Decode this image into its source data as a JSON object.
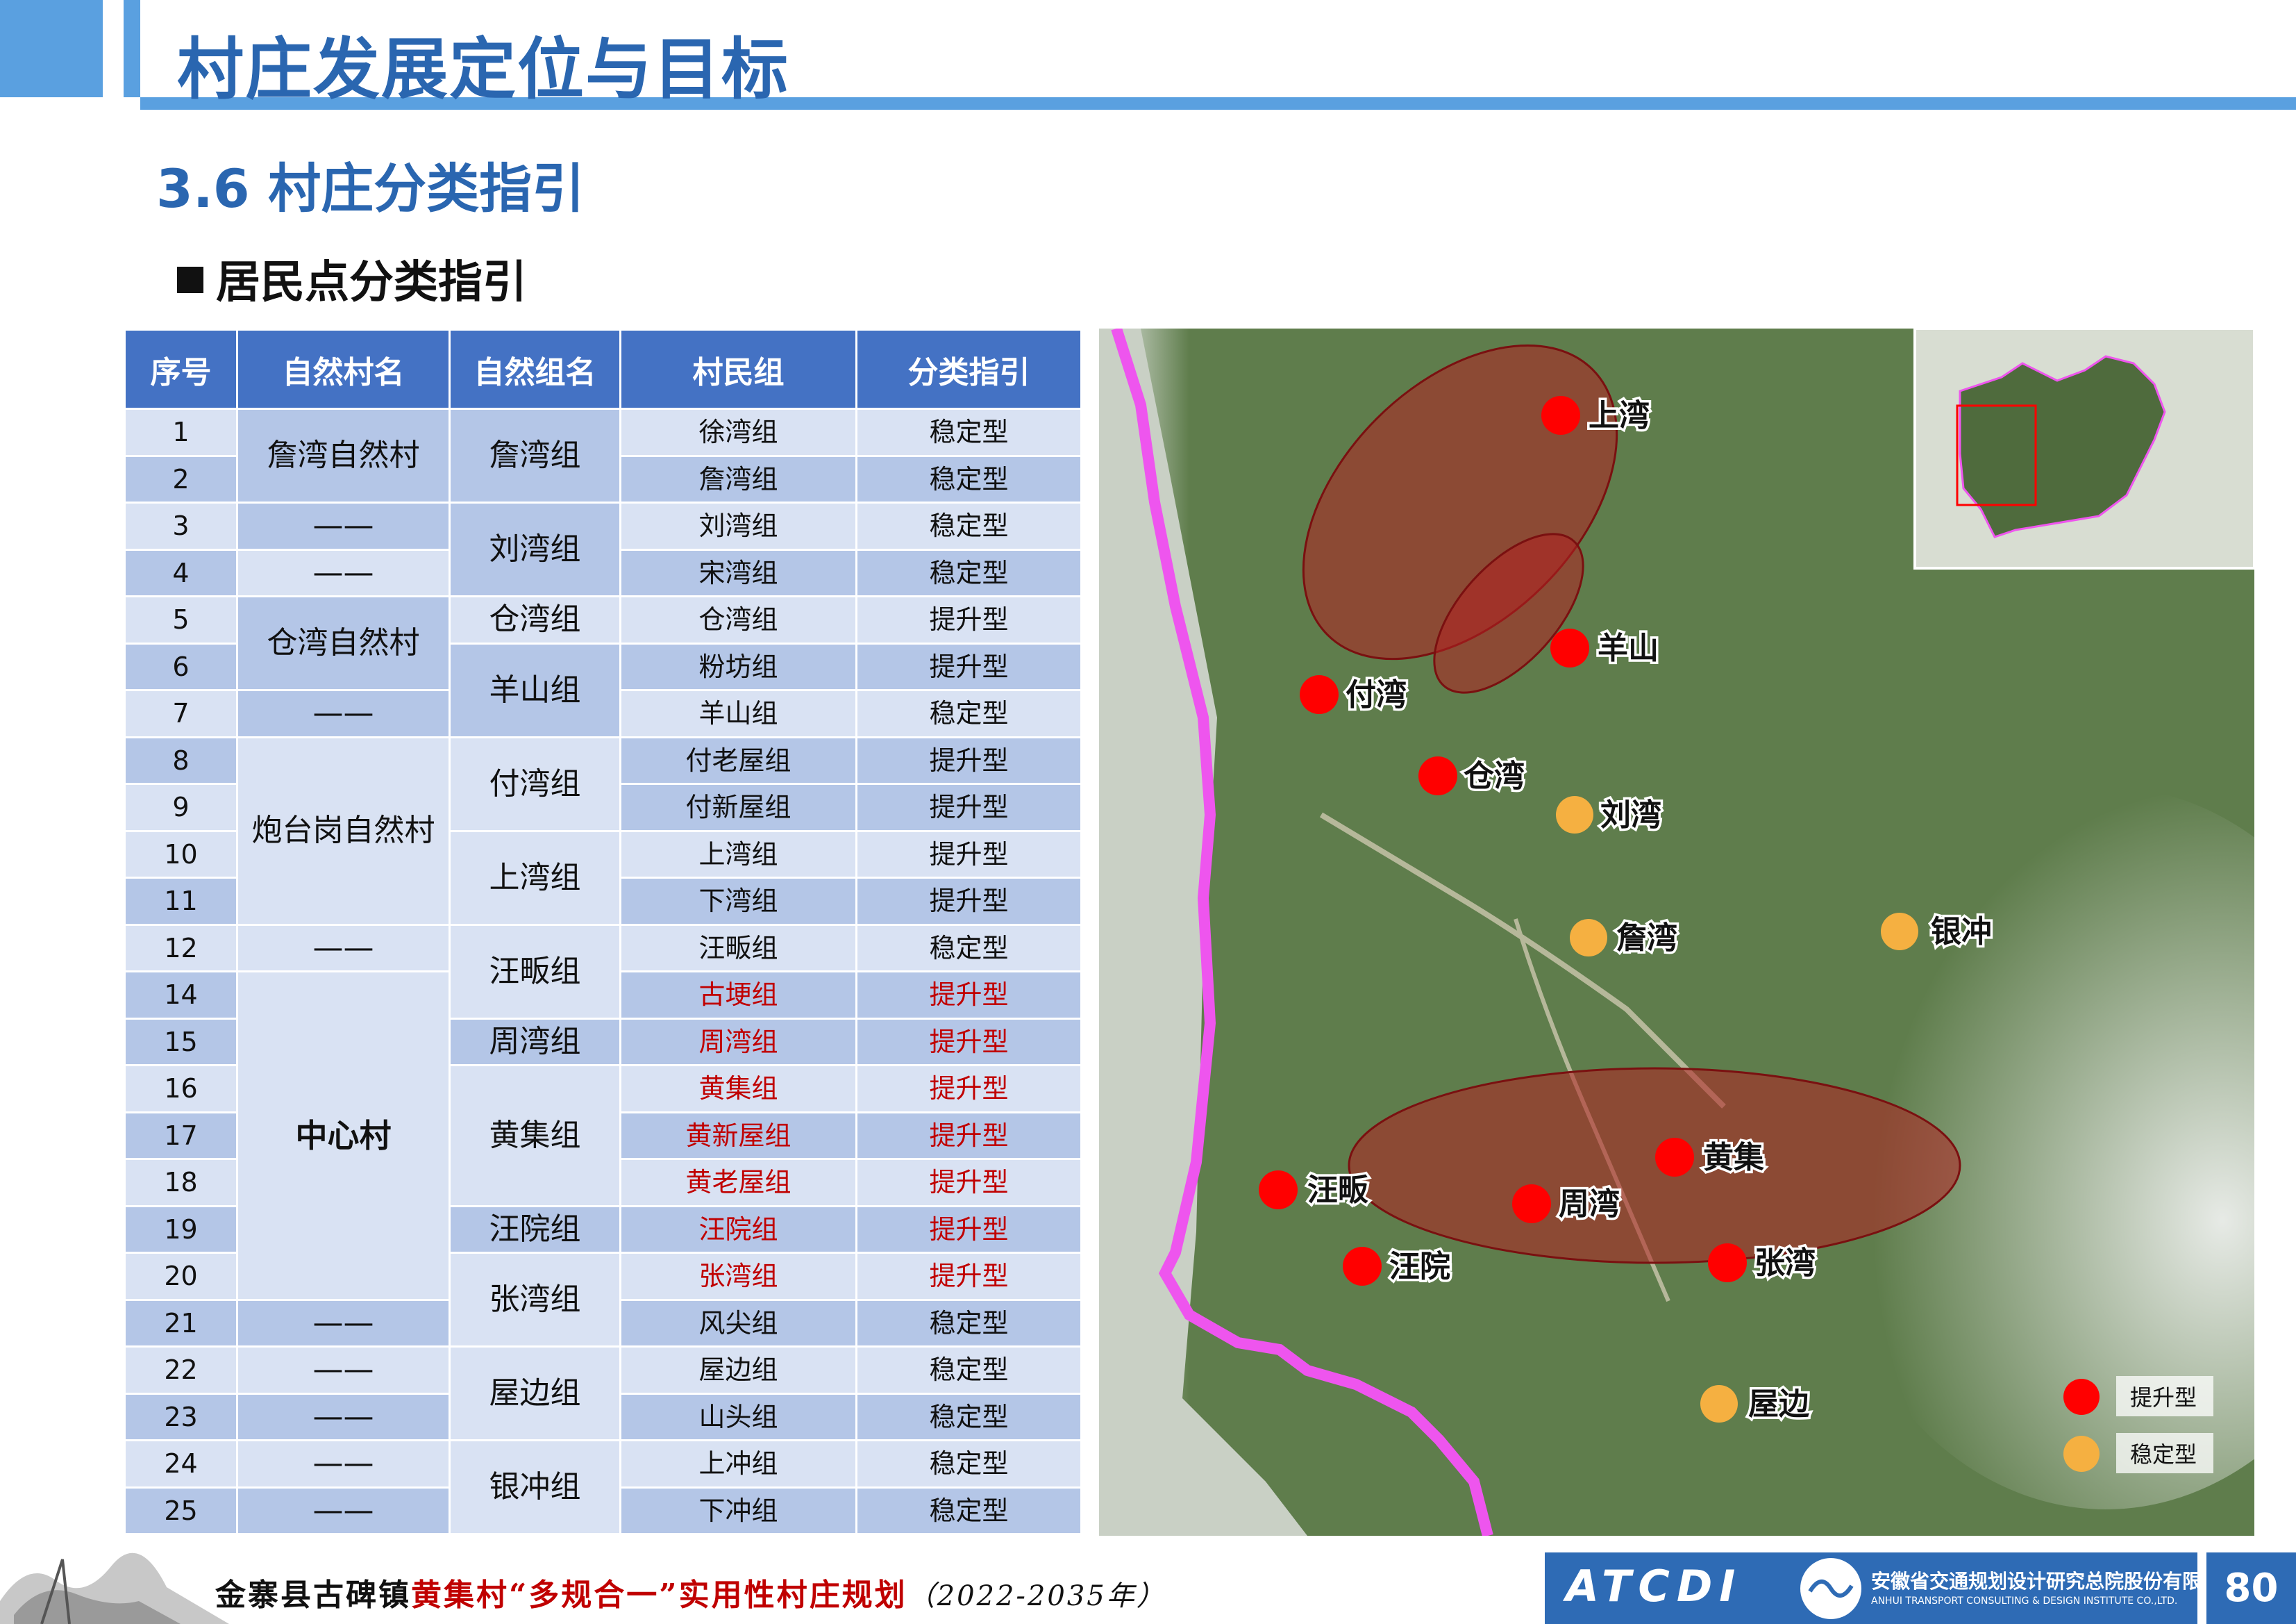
{
  "header": {
    "title": "村庄发展定位与目标"
  },
  "section_title": "3.6 村庄分类指引",
  "sub_title": "居民点分类指引",
  "table": {
    "headers": [
      "序号",
      "自然村名",
      "自然组名",
      "村民组",
      "分类指引"
    ],
    "rows": [
      {
        "no": "1",
        "natural_village": "詹湾自然村",
        "natural_group": "詹湾组",
        "villager_group": "徐湾组",
        "guide": "稳定型"
      },
      {
        "no": "2",
        "natural_village": "",
        "natural_group": "",
        "villager_group": "詹湾组",
        "guide": "稳定型"
      },
      {
        "no": "3",
        "natural_village": "——",
        "natural_group": "刘湾组",
        "villager_group": "刘湾组",
        "guide": "稳定型"
      },
      {
        "no": "4",
        "natural_village": "——",
        "natural_group": "",
        "villager_group": "宋湾组",
        "guide": "稳定型"
      },
      {
        "no": "5",
        "natural_village": "仓湾自然村",
        "natural_group": "仓湾组",
        "villager_group": "仓湾组",
        "guide": "提升型"
      },
      {
        "no": "6",
        "natural_village": "",
        "natural_group": "羊山组",
        "villager_group": "粉坊组",
        "guide": "提升型"
      },
      {
        "no": "7",
        "natural_village": "——",
        "natural_group": "",
        "villager_group": "羊山组",
        "guide": "稳定型"
      },
      {
        "no": "8",
        "natural_village": "炮台岗自然村",
        "natural_group": "付湾组",
        "villager_group": "付老屋组",
        "guide": "提升型"
      },
      {
        "no": "9",
        "natural_village": "",
        "natural_group": "",
        "villager_group": "付新屋组",
        "guide": "提升型"
      },
      {
        "no": "10",
        "natural_village": "",
        "natural_group": "上湾组",
        "villager_group": "上湾组",
        "guide": "提升型"
      },
      {
        "no": "11",
        "natural_village": "",
        "natural_group": "",
        "villager_group": "下湾组",
        "guide": "提升型"
      },
      {
        "no": "12",
        "natural_village": "——",
        "natural_group": "汪畈组",
        "villager_group": "汪畈组",
        "guide": "稳定型"
      },
      {
        "no": "14",
        "natural_village": "中心村",
        "natural_group": "",
        "villager_group": "古埂组",
        "guide": "提升型"
      },
      {
        "no": "15",
        "natural_village": "",
        "natural_group": "周湾组",
        "villager_group": "周湾组",
        "guide": "提升型"
      },
      {
        "no": "16",
        "natural_village": "",
        "natural_group": "黄集组",
        "villager_group": "黄集组",
        "guide": "提升型"
      },
      {
        "no": "17",
        "natural_village": "",
        "natural_group": "",
        "villager_group": "黄新屋组",
        "guide": "提升型"
      },
      {
        "no": "18",
        "natural_village": "",
        "natural_group": "",
        "villager_group": "黄老屋组",
        "guide": "提升型"
      },
      {
        "no": "19",
        "natural_village": "",
        "natural_group": "汪院组",
        "villager_group": "汪院组",
        "guide": "提升型"
      },
      {
        "no": "20",
        "natural_village": "",
        "natural_group": "张湾组",
        "villager_group": "张湾组",
        "guide": "提升型"
      },
      {
        "no": "21",
        "natural_village": "——",
        "natural_group": "",
        "villager_group": "风尖组",
        "guide": "稳定型"
      },
      {
        "no": "22",
        "natural_village": "——",
        "natural_group": "屋边组",
        "villager_group": "屋边组",
        "guide": "稳定型"
      },
      {
        "no": "23",
        "natural_village": "——",
        "natural_group": "",
        "villager_group": "山头组",
        "guide": "稳定型"
      },
      {
        "no": "24",
        "natural_village": "——",
        "natural_group": "银冲组",
        "villager_group": "上冲组",
        "guide": "稳定型"
      },
      {
        "no": "25",
        "natural_village": "——",
        "natural_group": "",
        "villager_group": "下冲组",
        "guide": "稳定型"
      }
    ]
  },
  "map": {
    "markers": [
      {
        "name": "上湾",
        "type": "提升型"
      },
      {
        "name": "羊山",
        "type": "提升型"
      },
      {
        "name": "付湾",
        "type": "提升型"
      },
      {
        "name": "仓湾",
        "type": "提升型"
      },
      {
        "name": "刘湾",
        "type": "稳定型"
      },
      {
        "name": "詹湾",
        "type": "稳定型"
      },
      {
        "name": "银冲",
        "type": "稳定型"
      },
      {
        "name": "黄集",
        "type": "提升型"
      },
      {
        "name": "汪畈",
        "type": "提升型"
      },
      {
        "name": "周湾",
        "type": "提升型"
      },
      {
        "name": "汪院",
        "type": "提升型"
      },
      {
        "name": "张湾",
        "type": "提升型"
      },
      {
        "name": "屋边",
        "type": "稳定型"
      }
    ],
    "legend": [
      {
        "label": "提升型",
        "color": "#ff0000"
      },
      {
        "label": "稳定型",
        "color": "#f5b041"
      }
    ],
    "colors": {
      "upgrade": "#ff0000",
      "stable": "#f5b041",
      "boundary": "#ee55ee"
    }
  },
  "footer": {
    "text_a": "金寨县古碑镇",
    "text_b": "黄集村",
    "text_c": "“多规合一”实用性村庄规划",
    "text_d": "（2022-2035年）",
    "logo_mark": "ATCDI",
    "company_cn": "安徽省交通规划设计研究总院股份有限公司",
    "company_en": "ANHUI TRANSPORT CONSULTING & DESIGN INSTITUTE CO.,LTD.",
    "page": "80"
  }
}
